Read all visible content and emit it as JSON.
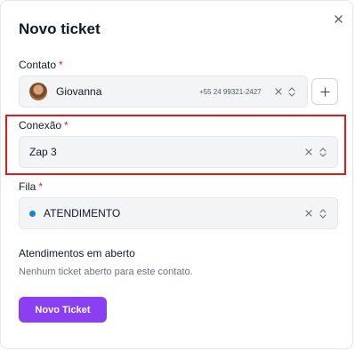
{
  "dialog": {
    "title": "Novo ticket"
  },
  "contact": {
    "label": "Contato",
    "required_mark": "*",
    "name": "Giovanna",
    "phone": "+55 24 99321-2427"
  },
  "connection": {
    "label": "Conexão",
    "required_mark": "*",
    "value": "Zap 3"
  },
  "queue": {
    "label": "Fila",
    "required_mark": "*",
    "value": "ATENDIMENTO",
    "color": "#1d7fc9"
  },
  "open_tickets": {
    "title": "Atendimentos em aberto",
    "empty_text": "Nenhum ticket aberto para este contato."
  },
  "actions": {
    "submit_label": "Novo Ticket"
  },
  "colors": {
    "primary": "#8a3ff0",
    "required": "#e11d48",
    "highlight": "#e11919"
  },
  "icons": {
    "close": "close-icon",
    "clear": "clear-x-icon",
    "sort": "chevron-up-down-icon",
    "plus": "plus-icon"
  }
}
